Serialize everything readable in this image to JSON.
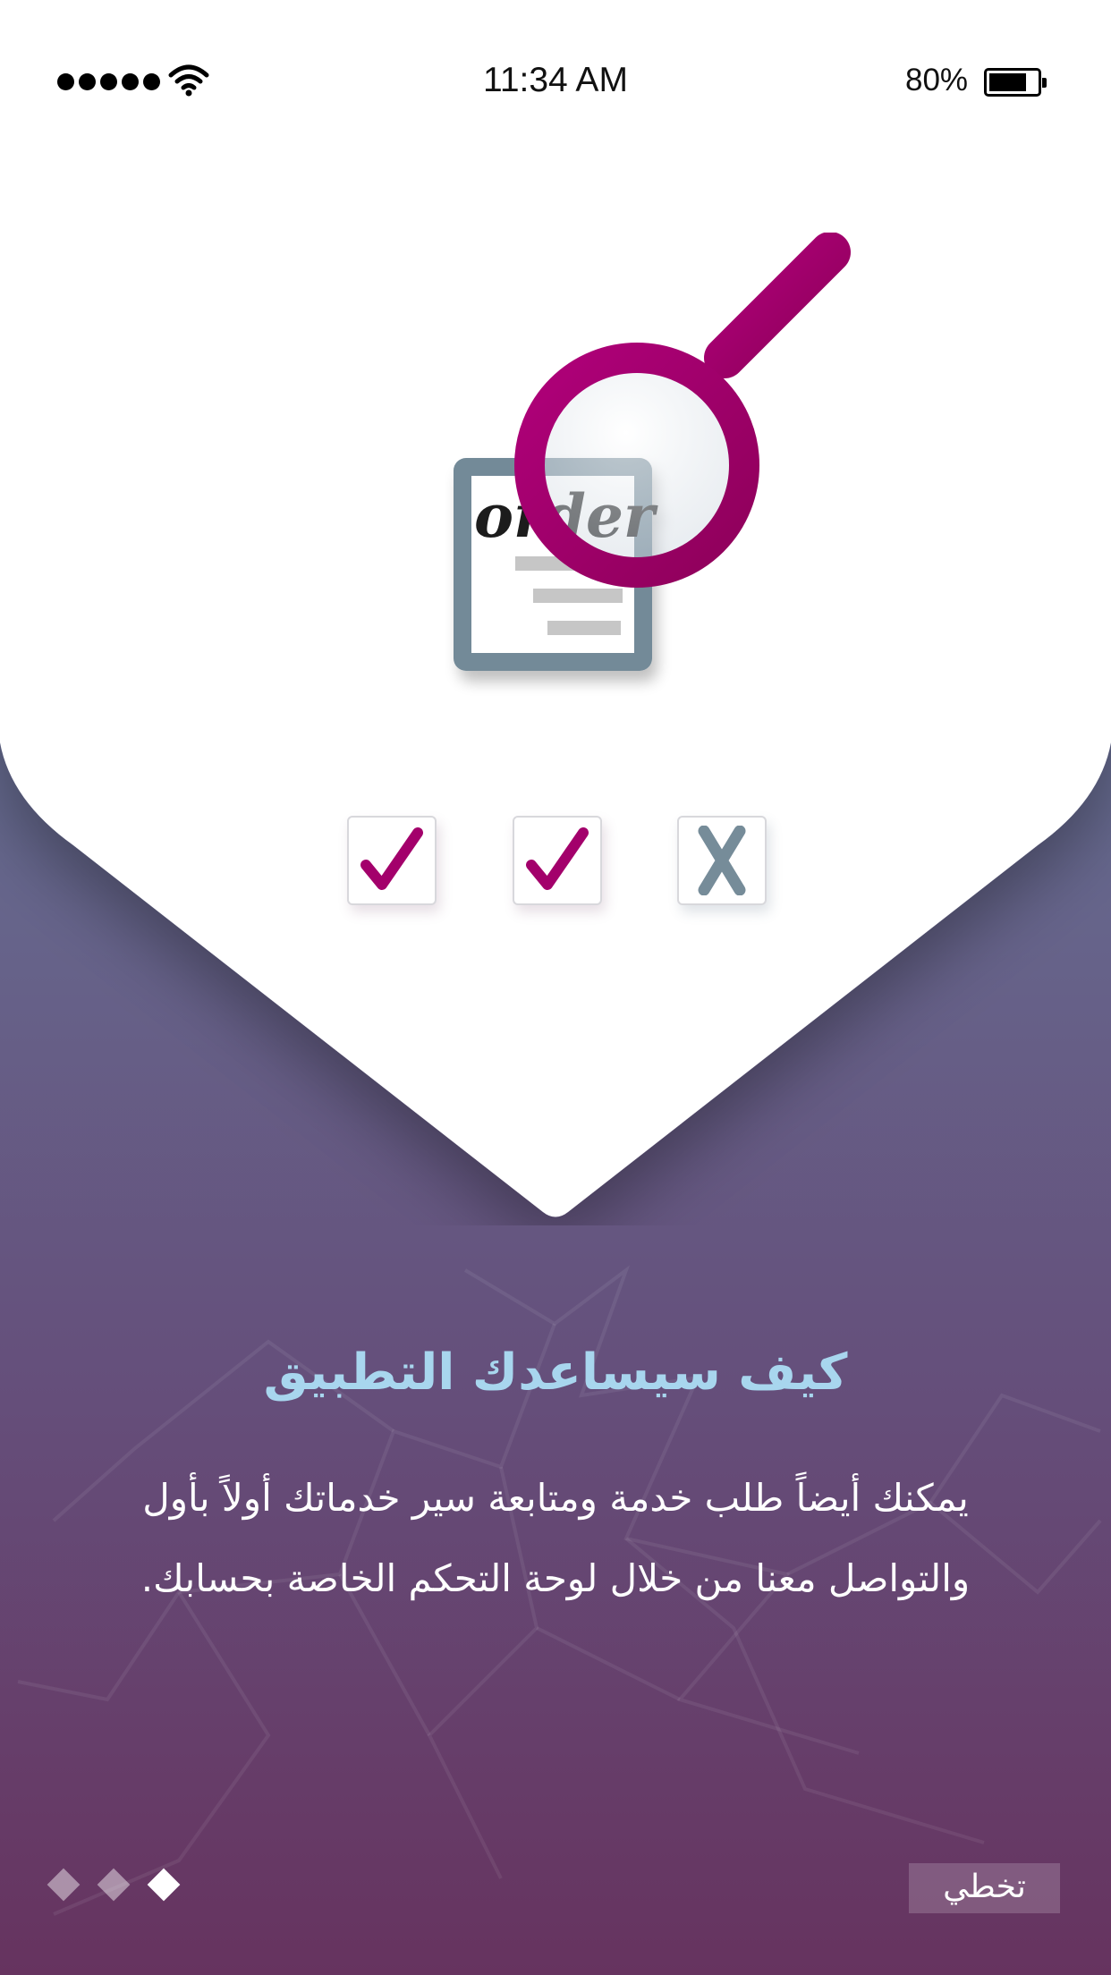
{
  "status_bar": {
    "time": "11:34 AM",
    "battery_percent": "80%",
    "battery_level": 0.8,
    "signal_bars": 5,
    "icons": [
      "signal-icon",
      "wifi-icon",
      "battery-icon"
    ]
  },
  "illustration": {
    "document_word": "order",
    "magnifier_color": "#a8006e",
    "document_color": "#738a98",
    "checkboxes": [
      {
        "state": "checked",
        "symbol": "✔",
        "color": "#a3006b"
      },
      {
        "state": "checked",
        "symbol": "✔",
        "color": "#a3006b"
      },
      {
        "state": "crossed",
        "symbol": "X",
        "color": "#768c99"
      }
    ]
  },
  "content": {
    "title": "كيف سيساعدك التطبيق",
    "description_line1": "يمكنك أيضاً طلب خدمة ومتابعة سير خدماتك أولاً بأول",
    "description_line2": "والتواصل معنا من خلال لوحة التحكم الخاصة بحسابك."
  },
  "pager": {
    "total": 3,
    "active_index": 2
  },
  "skip_button": {
    "label": "تخطي"
  },
  "colors": {
    "title": "#a8d6ee",
    "background_top": "#5a6d92",
    "background_bottom": "#66335f",
    "accent": "#a3006b"
  }
}
